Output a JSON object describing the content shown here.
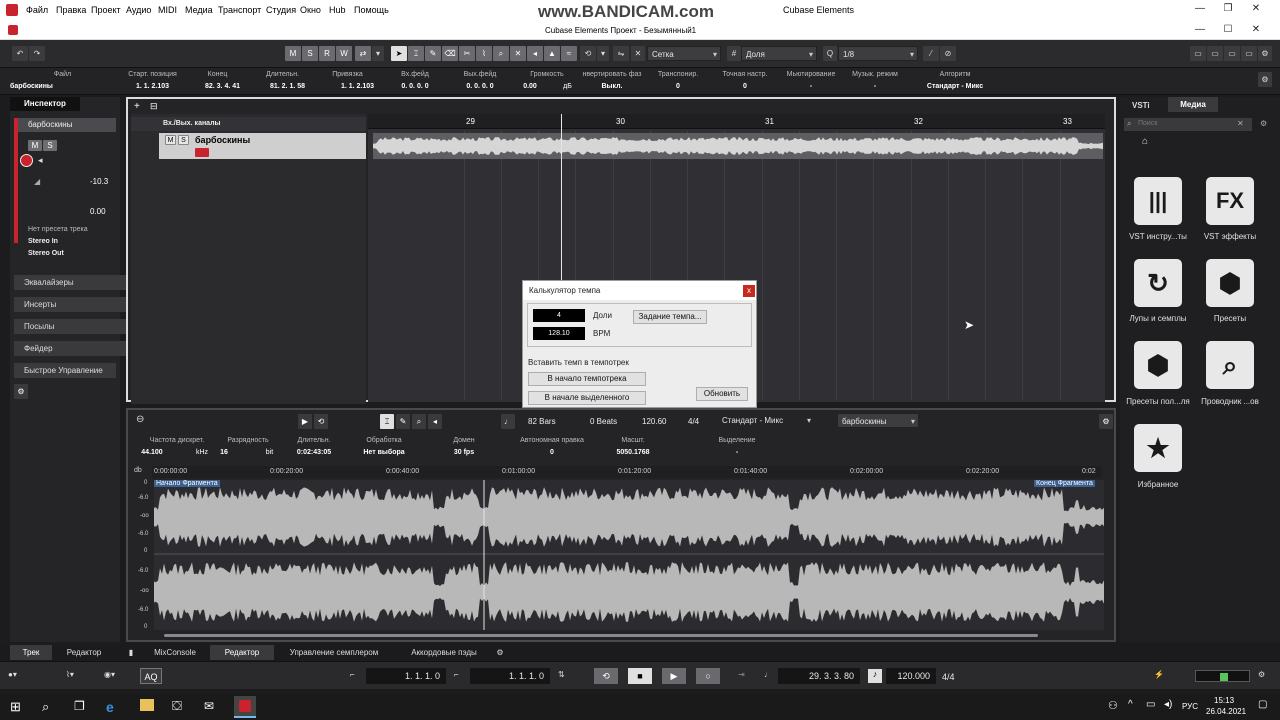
{
  "menu": [
    "Файл",
    "Правка",
    "Проект",
    "Аудио",
    "MIDI",
    "Медиа",
    "Транспорт",
    "Студия",
    "Окно",
    "Hub",
    "Помощь"
  ],
  "watermark": "www.BANDICAM.com",
  "app_title": "Cubase Elements",
  "window_title": "Cubase Elements Проект - Безымянный1",
  "toolbar": {
    "mode_buttons": [
      "M",
      "S",
      "R",
      "W"
    ],
    "snap_type": "Сетка",
    "grid": "Доля",
    "quantize": "1/8"
  },
  "info_line": [
    {
      "h": "Файл",
      "v": "барбоскины"
    },
    {
      "h": "Старт. позиция",
      "v": "1. 1. 2.103"
    },
    {
      "h": "Конец",
      "v": "82. 3. 4. 41"
    },
    {
      "h": "Длительн.",
      "v": "81. 2. 1. 58"
    },
    {
      "h": "Привязка",
      "v": "1. 1. 2.103"
    },
    {
      "h": "Вх.фейд",
      "v": "0. 0. 0. 0"
    },
    {
      "h": "Вых.фейд",
      "v": "0. 0. 0. 0"
    },
    {
      "h": "Громкость",
      "v": "0.00"
    },
    {
      "h": "нвертировать фаз",
      "v": "Выкл."
    },
    {
      "h": "Транспонир.",
      "v": "0"
    },
    {
      "h": "Точная настр.",
      "v": "0"
    },
    {
      "h": "Мьютирование",
      "v": "-"
    },
    {
      "h": "Музык. режим",
      "v": "-"
    },
    {
      "h": "Алгоритм",
      "v": "Стандарт - Микс"
    }
  ],
  "info_unit": "дБ",
  "inspector": {
    "tab": "Инспектор",
    "track_name": "барбоскины",
    "volume": "-10.3",
    "pan": "0.00",
    "preset": "Нет пресета трека",
    "input": "Stereo In",
    "output": "Stereo Out",
    "sections": [
      "Эквалайзеры",
      "Инсерты",
      "Посылы",
      "Фейдер",
      "Быстрое Управление"
    ]
  },
  "project": {
    "folder": "Вх./Вых. каналы",
    "track_name": "барбоскины",
    "ruler": [
      "29",
      "30",
      "31",
      "32",
      "33"
    ]
  },
  "editor": {
    "toolbar": {
      "bars": "82 Bars",
      "beats": "0 Beats",
      "tempo": "120.60",
      "signature": "4/4",
      "algorithm": "Стандарт - Микс",
      "clip": "барбоскины"
    },
    "info": [
      {
        "h": "Частота дискрет.",
        "v": "44.100",
        "u": "kHz"
      },
      {
        "h": "Разрядность",
        "v": "16",
        "u": "bit"
      },
      {
        "h": "Длительн.",
        "v": "0:02:43:05",
        "u": ""
      },
      {
        "h": "Обработка",
        "v": "Нет выбора",
        "u": ""
      },
      {
        "h": "Домен",
        "v": "30 fps",
        "u": ""
      },
      {
        "h": "Автономная правка",
        "v": "0",
        "u": ""
      },
      {
        "h": "Масшт.",
        "v": "5050.1768",
        "u": ""
      },
      {
        "h": "Выделение",
        "v": "-",
        "u": ""
      }
    ],
    "db_label": "db",
    "timeline": [
      "0:00:00:00",
      "0:00:20:00",
      "0:00:40:00",
      "0:01:00:00",
      "0:01:20:00",
      "0:01:40:00",
      "0:02:00:00",
      "0:02:20:00",
      "0:02"
    ],
    "start_marker": "Начало Фрагмента",
    "end_marker": "Конец Фрагмента",
    "scale": [
      "0",
      "-6.0",
      "-oo",
      "-6.0",
      "0",
      "-6.0",
      "-oo",
      "-6.0",
      "0"
    ]
  },
  "dialog": {
    "title": "Калькулятор темпа",
    "beats_value": "4",
    "beats_label": "Доли",
    "bpm_value": "128.10",
    "bpm_label": "BPM",
    "set_tempo": "Задание темпа...",
    "insert_label": "Вставить темп в темпотрек",
    "btn_start": "В начало темпотрека",
    "btn_selection": "В начале выделенного",
    "btn_refresh": "Обновить"
  },
  "media": {
    "tabs": [
      "VSTi",
      "Медиа"
    ],
    "search_placeholder": "Поиск",
    "tiles": [
      {
        "icon": "keys-icon",
        "glyph": "|||",
        "label": "VST инстру...ты"
      },
      {
        "icon": "fx-icon",
        "glyph": "FX",
        "label": "VST эффекты"
      },
      {
        "icon": "loop-icon",
        "glyph": "↻",
        "label": "Лупы и семплы"
      },
      {
        "icon": "presets-icon",
        "glyph": "⬢",
        "label": "Пресеты"
      },
      {
        "icon": "user-presets-icon",
        "glyph": "⬢",
        "label": "Пресеты пол...ля"
      },
      {
        "icon": "browser-icon",
        "glyph": "⌕",
        "label": "Проводник ...ов"
      },
      {
        "icon": "star-icon",
        "glyph": "★",
        "label": "Избранное"
      }
    ]
  },
  "bottom_tabs": [
    "Трек",
    "Редактор",
    "MixConsole",
    "Редактор",
    "Управление семплером",
    "Аккордовые пэды"
  ],
  "transport": {
    "aq": "AQ",
    "left_locator": "1. 1. 1.   0",
    "right_locator": "1. 1. 1.   0",
    "position": "29. 3. 3. 80",
    "tempo": "120.000",
    "signature": "4/4"
  },
  "taskbar": {
    "lang": "РУС",
    "time": "15:13",
    "date": "26.04.2021"
  },
  "colors": {
    "accent": "#c9242e",
    "panel": "#242427",
    "dialog": "#ededed",
    "tile": "#e8e8e8"
  }
}
